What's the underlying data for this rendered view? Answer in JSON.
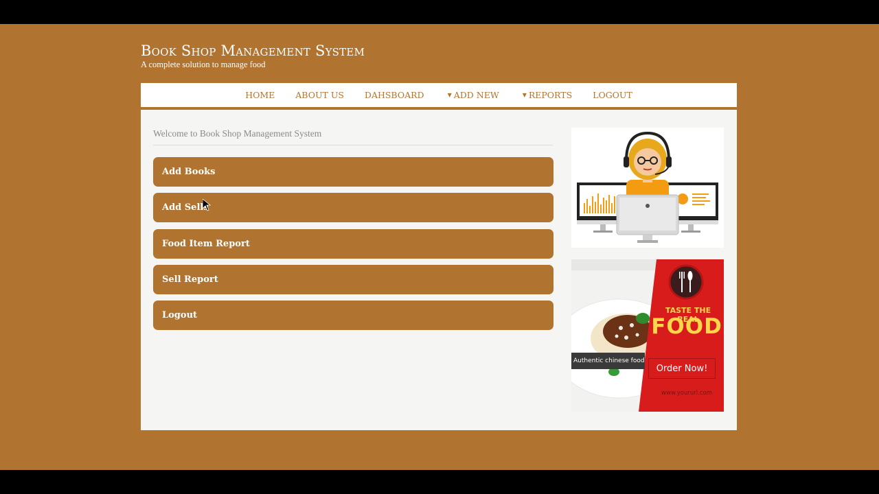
{
  "header": {
    "title": "Book Shop Management System",
    "tagline": "A complete solution to manage food"
  },
  "nav": {
    "home": "HOME",
    "about": "ABOUT US",
    "dashboard": "DAHSBOARD",
    "add_new": "ADD NEW",
    "reports": "REPORTS",
    "logout": "LOGOUT"
  },
  "main": {
    "welcome": "Welcome to Book Shop Management System",
    "menu": [
      {
        "label": "Add Books"
      },
      {
        "label": "Add Sells"
      },
      {
        "label": "Food Item Report"
      },
      {
        "label": "Sell Report"
      },
      {
        "label": "Logout"
      }
    ]
  },
  "ads": {
    "food": {
      "caption": "Authentic chinese food",
      "taste": "TASTE THE REAL",
      "food": "FOOD",
      "order": "Order Now!",
      "url": "www.yoururl.com"
    }
  },
  "colors": {
    "brand": "#b07430",
    "ad_red": "#d81c1c",
    "ad_yellow": "#ffd54a"
  }
}
